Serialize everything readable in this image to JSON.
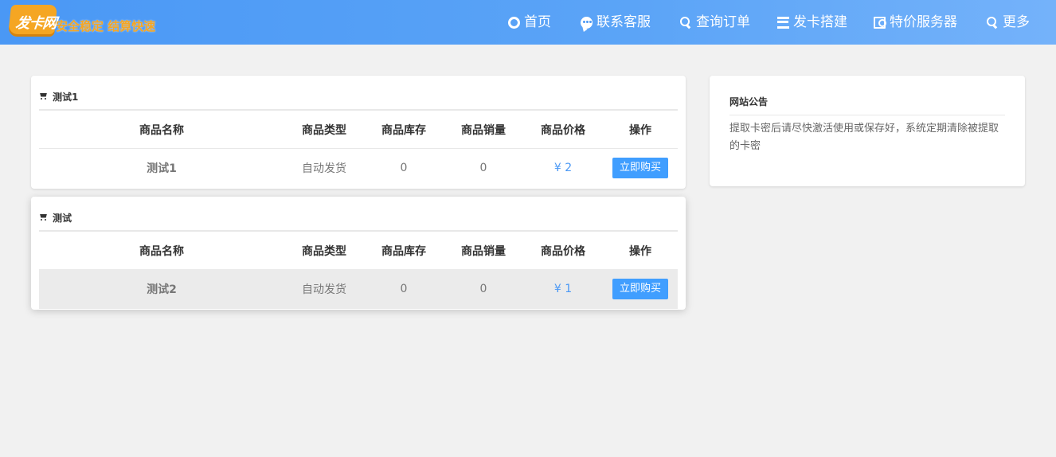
{
  "brand": {
    "badge_text": "发卡网",
    "slogan": "安全稳定 结算快速",
    "colors": {
      "header_start": "#4a98f5",
      "header_end": "#74b2fa",
      "logo_orange": "#f5a623"
    }
  },
  "nav": [
    {
      "label": "首页",
      "icon": "opera-icon"
    },
    {
      "label": "联系客服",
      "icon": "comment-icon"
    },
    {
      "label": "查询订单",
      "icon": "search-icon"
    },
    {
      "label": "发卡搭建",
      "icon": "bars-icon"
    },
    {
      "label": "特价服务器",
      "icon": "money-icon"
    },
    {
      "label": "更多",
      "icon": "search-icon"
    }
  ],
  "categories": [
    {
      "title": "测试1",
      "headers": {
        "name": "商品名称",
        "type": "商品类型",
        "stock": "商品库存",
        "sold": "商品销量",
        "price": "商品价格",
        "op": "操作"
      },
      "items": [
        {
          "name": "测试1",
          "type": "自动发货",
          "stock": "0",
          "sold": "0",
          "price": "¥ 2",
          "buy": "立即购买"
        }
      ]
    },
    {
      "title": "测试",
      "headers": {
        "name": "商品名称",
        "type": "商品类型",
        "stock": "商品库存",
        "sold": "商品销量",
        "price": "商品价格",
        "op": "操作"
      },
      "items": [
        {
          "name": "测试2",
          "type": "自动发货",
          "stock": "0",
          "sold": "0",
          "price": "¥ 1",
          "buy": "立即购买"
        }
      ]
    }
  ],
  "notice": {
    "title": "网站公告",
    "body": "提取卡密后请尽快激活使用或保存好，系统定期清除被提取的卡密"
  },
  "accent": {
    "price_color": "#4a98f5",
    "button_color": "#409eff"
  }
}
